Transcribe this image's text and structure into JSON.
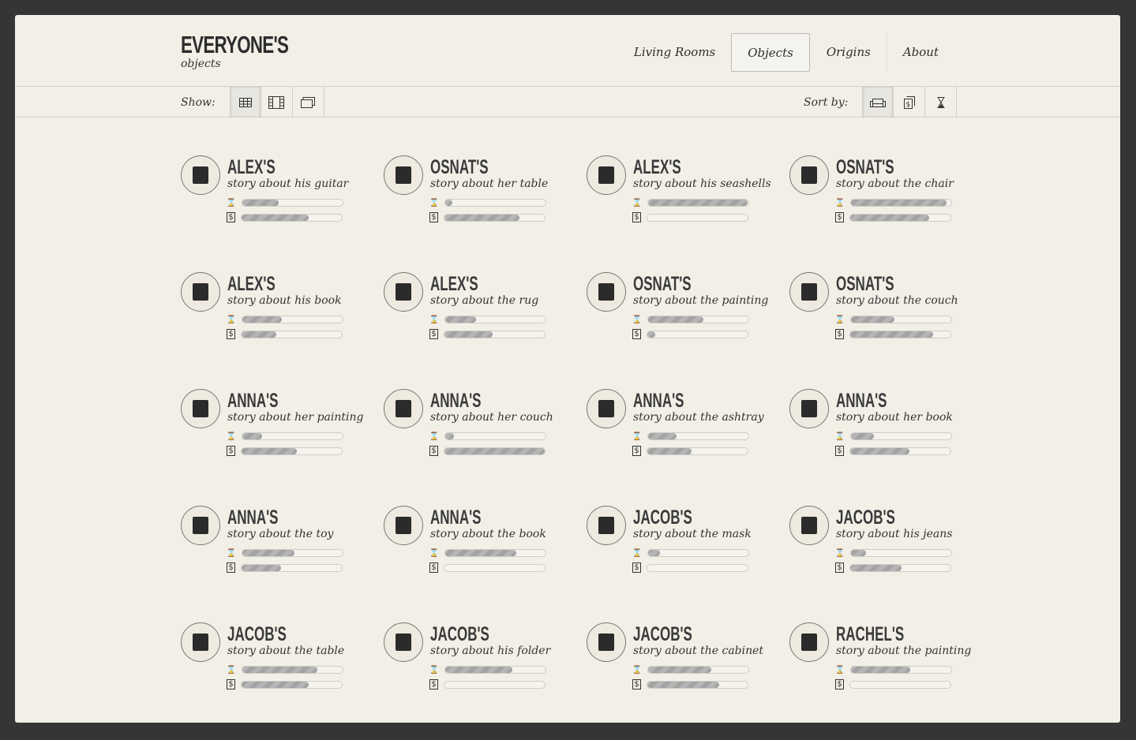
{
  "header": {
    "title": "EVERYONE'S",
    "subtitle": "objects"
  },
  "nav": [
    {
      "label": "Living Rooms",
      "active": false
    },
    {
      "label": "Objects",
      "active": true
    },
    {
      "label": "Origins",
      "active": false
    },
    {
      "label": "About",
      "active": false
    }
  ],
  "toolbar": {
    "show_label": "Show:",
    "show_options": [
      "grid-icon",
      "filmstrip-icon",
      "window-icon"
    ],
    "show_active": 0,
    "sort_label": "Sort by:",
    "sort_options": [
      "couch-icon",
      "money-icon",
      "hourglass-icon"
    ],
    "sort_active": 0
  },
  "cards": [
    {
      "owner": "ALEX'S",
      "story": "story about his guitar",
      "icon": "guitar-icon",
      "time": 36,
      "money": 67
    },
    {
      "owner": "OSNAT'S",
      "story": "story about her table",
      "icon": "table-icon",
      "time": 7,
      "money": 75
    },
    {
      "owner": "ALEX'S",
      "story": "story about his seashells",
      "icon": "seashell-icon",
      "time": 99,
      "money": 0
    },
    {
      "owner": "OSNAT'S",
      "story": "story about the chair",
      "icon": "chair-icon",
      "time": 95,
      "money": 79
    },
    {
      "owner": "ALEX'S",
      "story": "story about his book",
      "icon": "book-icon",
      "time": 39,
      "money": 35
    },
    {
      "owner": "ALEX'S",
      "story": "story about the rug",
      "icon": "rug-icon",
      "time": 31,
      "money": 48
    },
    {
      "owner": "OSNAT'S",
      "story": "story about the painting",
      "icon": "painting-icon",
      "time": 55,
      "money": 8
    },
    {
      "owner": "OSNAT'S",
      "story": "story about the couch",
      "icon": "couch-icon",
      "time": 43,
      "money": 83
    },
    {
      "owner": "ANNA'S",
      "story": "story about her painting",
      "icon": "painting-icon",
      "time": 20,
      "money": 55
    },
    {
      "owner": "ANNA'S",
      "story": "story about her couch",
      "icon": "couch-icon",
      "time": 9,
      "money": 100
    },
    {
      "owner": "ANNA'S",
      "story": "story about the ashtray",
      "icon": "ashtray-icon",
      "time": 28,
      "money": 44
    },
    {
      "owner": "ANNA'S",
      "story": "story about her book",
      "icon": "book-icon",
      "time": 23,
      "money": 59
    },
    {
      "owner": "ANNA'S",
      "story": "story about the toy",
      "icon": "toy-icon",
      "time": 52,
      "money": 39
    },
    {
      "owner": "ANNA'S",
      "story": "story about the book",
      "icon": "book-icon",
      "time": 71,
      "money": 0
    },
    {
      "owner": "JACOB'S",
      "story": "story about the mask",
      "icon": "mask-icon",
      "time": 12,
      "money": 0
    },
    {
      "owner": "JACOB'S",
      "story": "story about his jeans",
      "icon": "jeans-icon",
      "time": 15,
      "money": 51
    },
    {
      "owner": "JACOB'S",
      "story": "story about the table",
      "icon": "table-icon",
      "time": 75,
      "money": 67
    },
    {
      "owner": "JACOB'S",
      "story": "story about his folder",
      "icon": "folder-icon",
      "time": 67,
      "money": 0
    },
    {
      "owner": "JACOB'S",
      "story": "story about the cabinet",
      "icon": "cabinet-icon",
      "time": 63,
      "money": 72
    },
    {
      "owner": "RACHEL'S",
      "story": "story about the painting",
      "icon": "painting-icon",
      "time": 59,
      "money": 0
    }
  ]
}
